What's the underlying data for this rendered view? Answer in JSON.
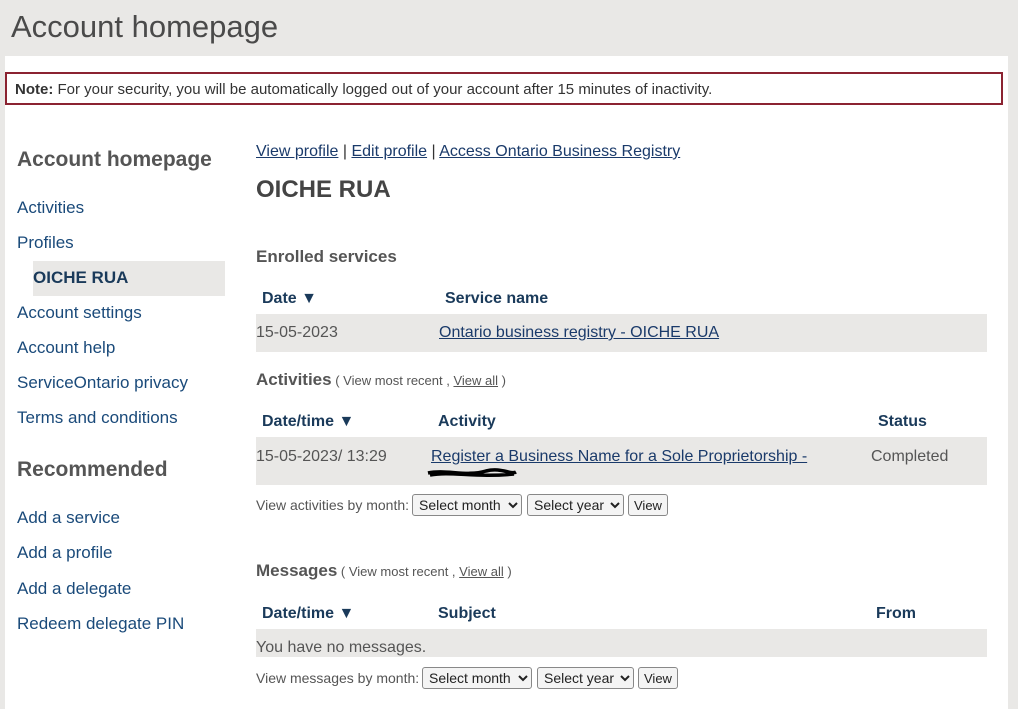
{
  "header": {
    "title": "Account homepage"
  },
  "note": {
    "label": "Note:",
    "text": " For your security, you will be automatically logged out of your account after 15 minutes of inactivity."
  },
  "sidebar": {
    "title": "Account homepage",
    "items": [
      {
        "label": "Activities"
      },
      {
        "label": "Profiles"
      },
      {
        "label": "OICHE RUA"
      },
      {
        "label": "Account settings"
      },
      {
        "label": "Account help"
      },
      {
        "label": "ServiceOntario privacy"
      },
      {
        "label": "Terms and conditions"
      }
    ],
    "recommended_title": "Recommended",
    "recommended": [
      {
        "label": "Add a service"
      },
      {
        "label": "Add a profile"
      },
      {
        "label": "Add a delegate"
      },
      {
        "label": "Redeem delegate PIN"
      }
    ]
  },
  "main": {
    "links": [
      "View profile",
      "Edit profile",
      "Access Ontario Business Registry"
    ],
    "separator": " | ",
    "profile_name": "OICHE RUA",
    "enrolled": {
      "title": "Enrolled services",
      "headers": {
        "date": "Date ▼",
        "service": "Service name"
      },
      "rows": [
        {
          "date": "15-05-2023",
          "service": "Ontario business registry  - OICHE RUA"
        }
      ]
    },
    "activities": {
      "title": "Activities",
      "open": " ( ",
      "view_recent": "View most recent",
      "comma": " , ",
      "view_all": "View all",
      "close": " )",
      "headers": {
        "date": "Date/time ▼",
        "activity": "Activity",
        "status": "Status"
      },
      "rows": [
        {
          "date": "15-05-2023/ 13:29",
          "activity": "Register a Business Name for a Sole Proprietorship -",
          "status": "Completed"
        }
      ],
      "filter_label": "View activities by month:",
      "month_placeholder": "Select month",
      "year_placeholder": "Select year",
      "view_button": "View"
    },
    "messages": {
      "title": "Messages",
      "open": " ( ",
      "view_recent": "View most recent",
      "comma": " , ",
      "view_all": "View all",
      "close": " )",
      "headers": {
        "date": "Date/time ▼",
        "subject": "Subject",
        "from": "From"
      },
      "empty": "You have no messages.",
      "filter_label": "View messages by month:",
      "month_placeholder": "Select month",
      "year_placeholder": "Select year",
      "view_button": "View"
    }
  }
}
